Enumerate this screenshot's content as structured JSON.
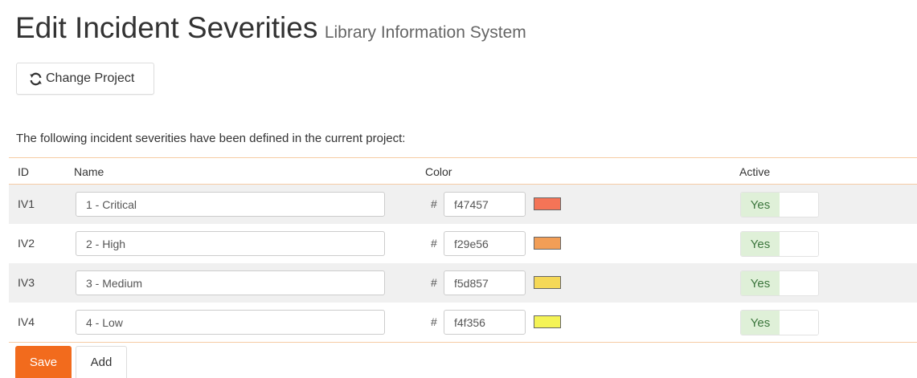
{
  "page": {
    "title": "Edit Incident Severities",
    "subtitle": "Library Information System"
  },
  "toolbar": {
    "change_project_label": "Change Project",
    "change_project_icon": "refresh-icon"
  },
  "intro_text": "The following incident severities have been defined in the current project:",
  "table": {
    "headers": {
      "id": "ID",
      "name": "Name",
      "color": "Color",
      "active": "Active"
    },
    "hash_symbol": "#",
    "rows": [
      {
        "id": "IV1",
        "name": "1 - Critical",
        "color": "f47457",
        "swatch": "#f47457",
        "active": "Yes"
      },
      {
        "id": "IV2",
        "name": "2 - High",
        "color": "f29e56",
        "swatch": "#f29e56",
        "active": "Yes"
      },
      {
        "id": "IV3",
        "name": "3 - Medium",
        "color": "f5d857",
        "swatch": "#f5d857",
        "active": "Yes"
      },
      {
        "id": "IV4",
        "name": "4 - Low",
        "color": "f4f356",
        "swatch": "#f4f356",
        "active": "Yes"
      }
    ]
  },
  "actions": {
    "save_label": "Save",
    "add_label": "Add"
  },
  "colors": {
    "accent": "#f26b1d",
    "header_border": "#f6cca4",
    "active_bg": "#dff0d8",
    "active_text": "#3c763d"
  }
}
